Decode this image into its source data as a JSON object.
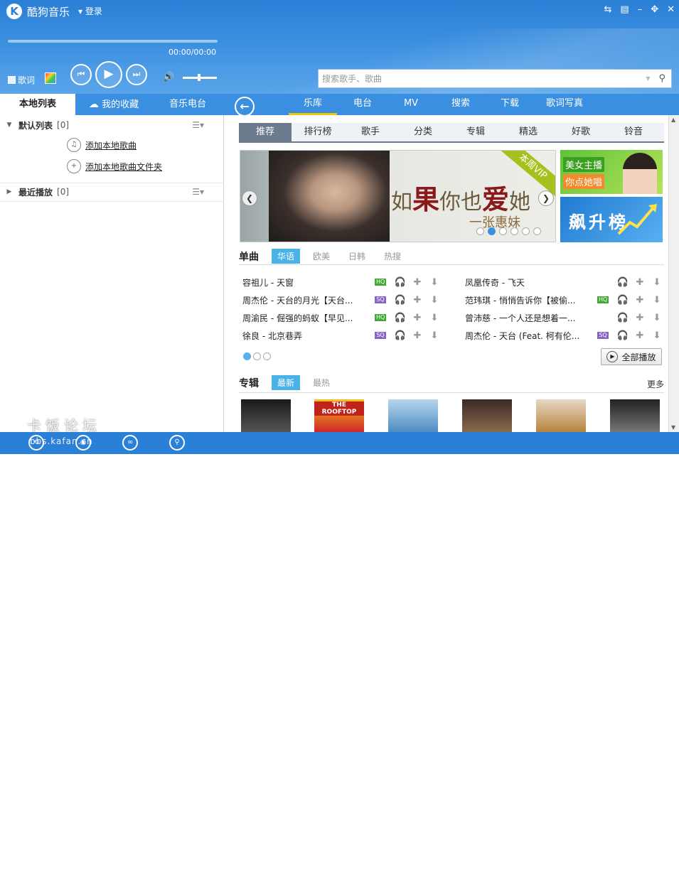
{
  "app": {
    "title": "酷狗音乐",
    "login": "登录",
    "logo_letter": "K"
  },
  "window_buttons": [
    "⇆",
    "▤",
    "–",
    "✥",
    "✕"
  ],
  "player": {
    "time": "00:00/00:00",
    "lyrics_label": "歌词",
    "progress": 0,
    "volume": 0.45
  },
  "search": {
    "placeholder": "搜索歌手、歌曲"
  },
  "left_tabs": [
    "本地列表",
    "我的收藏",
    "音乐电台"
  ],
  "main_tabs": [
    "乐库",
    "电台",
    "MV",
    "搜索",
    "下载",
    "歌词写真"
  ],
  "playlists": [
    {
      "name": "默认列表",
      "count": "[0]",
      "expanded": true
    },
    {
      "name": "最近播放",
      "count": "[0]",
      "expanded": false
    }
  ],
  "add_actions": [
    "添加本地歌曲",
    "添加本地歌曲文件夹"
  ],
  "sub_tabs": [
    "推荐",
    "排行榜",
    "歌手",
    "分类",
    "专辑",
    "精选",
    "好歌",
    "铃音"
  ],
  "banner": {
    "badge": "本周VIP",
    "line1a": "如",
    "line1b": "果",
    "line1c": "你也",
    "line1d": "爱",
    "line1e": "她",
    "line2": "一张惠妹"
  },
  "side_banners": {
    "first_a": "美女主播",
    "first_b": "你点她唱",
    "second": "飙升榜"
  },
  "singles": {
    "title": "单曲",
    "filters": [
      "华语",
      "欧美",
      "日韩",
      "热搜"
    ],
    "left": [
      {
        "name": "容祖儿 - 天窗",
        "quality": "HQ"
      },
      {
        "name": "周杰伦 - 天台的月光【天台...",
        "quality": "SQ"
      },
      {
        "name": "周渝民 - 倔强的蚂蚁【早见...",
        "quality": "HQ"
      },
      {
        "name": "徐良 - 北京巷弄",
        "quality": "SQ"
      }
    ],
    "right": [
      {
        "name": "凤凰传奇 - 飞天",
        "quality": ""
      },
      {
        "name": "范玮琪 - 悄悄告诉你【被偷...",
        "quality": "HQ"
      },
      {
        "name": "曾沛慈 - 一个人还是想着一...",
        "quality": ""
      },
      {
        "name": "周杰伦 - 天台 (Feat. 柯有伦...",
        "quality": "SQ"
      }
    ],
    "play_all": "全部播放"
  },
  "albums": {
    "title": "专辑",
    "filters": [
      "最新",
      "最热"
    ],
    "more": "更多",
    "covers": [
      "THE ROOFTOP",
      "",
      "",
      "",
      "",
      ""
    ]
  },
  "watermark": {
    "cn": "卡饭论坛",
    "url": "bbs.kafan.cn"
  },
  "colors": {
    "brand": "#2a7fd6",
    "accent_tab": "#f5c100",
    "hq": "#3ea933",
    "sq": "#8a63c9",
    "filter_active": "#4bb2e8"
  }
}
